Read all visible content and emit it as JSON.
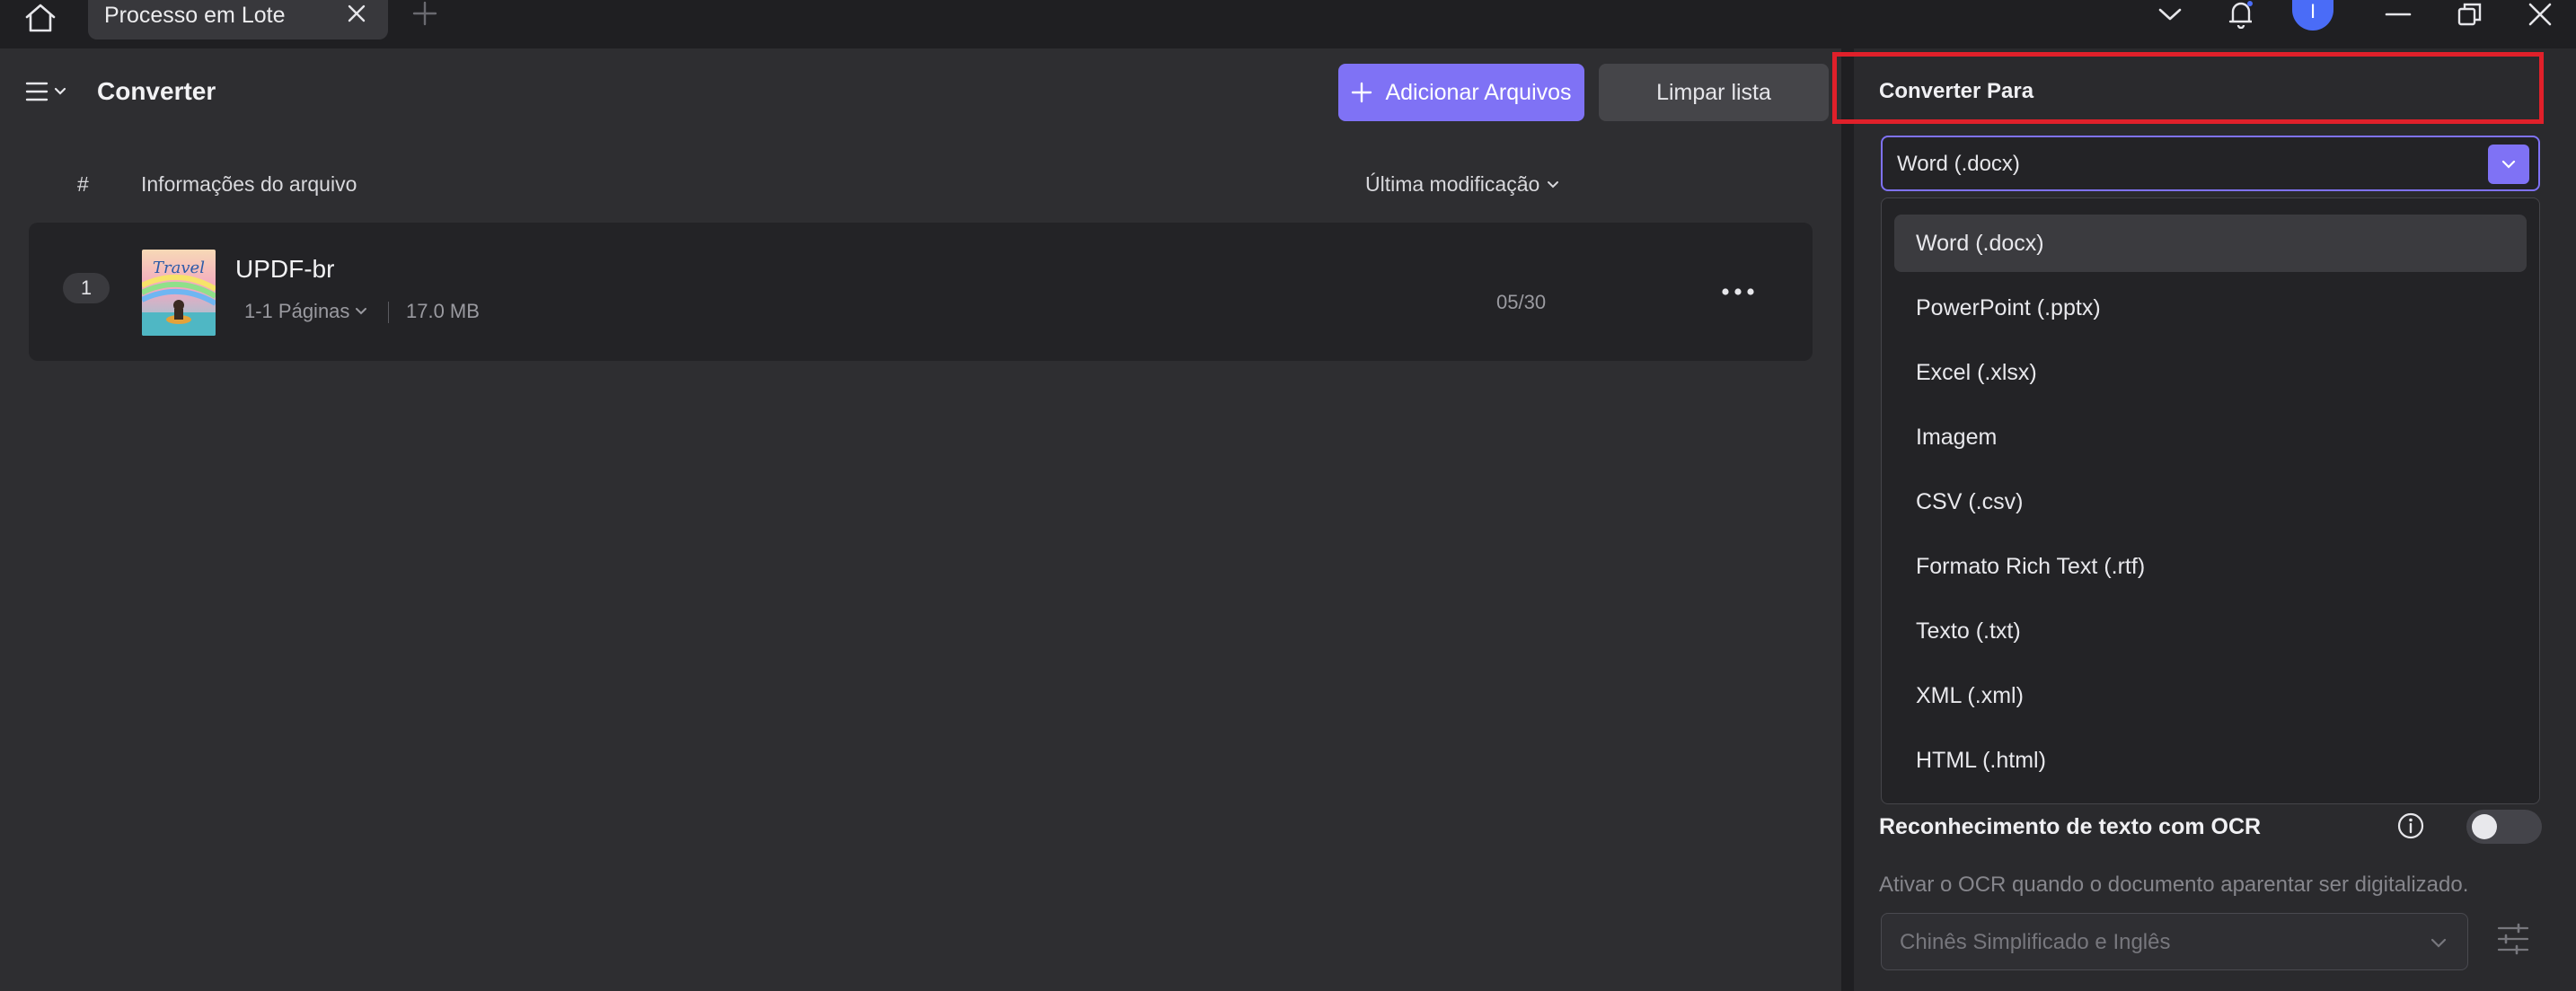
{
  "titlebar": {
    "tab_label": "Processo em Lote",
    "avatar_initial": "I",
    "icons": [
      "home-icon",
      "close-icon",
      "plus-icon",
      "chevron-down-icon",
      "bell-icon",
      "minimize-icon",
      "restore-icon",
      "close-window-icon"
    ]
  },
  "header": {
    "title": "Converter",
    "add_files_label": "Adicionar Arquivos",
    "clear_list_label": "Limpar lista"
  },
  "table": {
    "col_index": "#",
    "col_info": "Informações do arquivo",
    "col_modified": "Última modificação",
    "rows": [
      {
        "index": "1",
        "name": "UPDF-br",
        "pages": "1-1 Páginas",
        "size": "17.0 MB",
        "date": "05/30",
        "thumbnail_text": "Travel"
      }
    ]
  },
  "panel": {
    "title": "Converter Para",
    "selected_format": "Word (.docx)",
    "formats": [
      "Word (.docx)",
      "PowerPoint (.pptx)",
      "Excel (.xlsx)",
      "Imagem",
      "CSV (.csv)",
      "Formato Rich Text (.rtf)",
      "Texto (.txt)",
      "XML (.xml)",
      "HTML (.html)"
    ],
    "ocr_label": "Reconhecimento de texto com OCR",
    "ocr_enabled": false,
    "ocr_description": "Ativar o OCR quando o documento aparentar ser digitalizado.",
    "ocr_language": "Chinês Simplificado e Inglês"
  },
  "colors": {
    "accent": "#7f72f5",
    "highlight": "#e0202a",
    "avatar": "#4a6cf7"
  }
}
